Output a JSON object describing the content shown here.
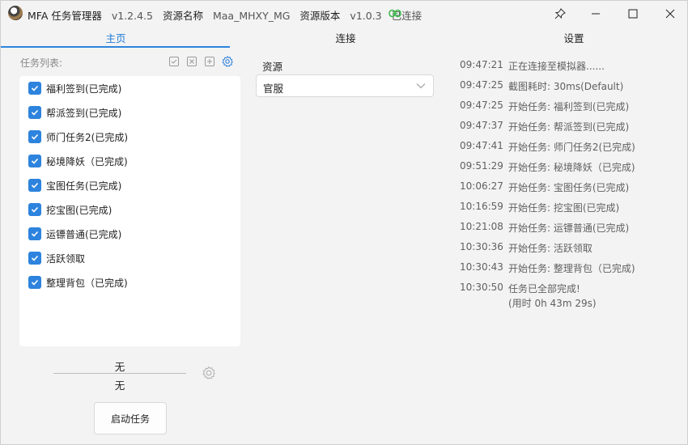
{
  "titlebar": {
    "app_name": "MFA 任务管理器",
    "version": "v1.2.4.5",
    "resource_name_label": "资源名称",
    "resource_name": "Maa_MHXY_MG",
    "resource_version_label": "资源版本",
    "resource_version": "v1.0.3",
    "connection_status": "已连接",
    "connection_color": "#3fb950"
  },
  "tabs": [
    {
      "label": "主页",
      "active": true
    },
    {
      "label": "连接",
      "active": false
    },
    {
      "label": "设置",
      "active": false
    }
  ],
  "task_panel": {
    "header": "任务列表:",
    "toolbar_icons": [
      "select-all-icon",
      "deselect-all-icon",
      "add-task-icon",
      "settings-icon"
    ],
    "items": [
      {
        "label": "福利签到(已完成)",
        "checked": true
      },
      {
        "label": "帮派签到(已完成)",
        "checked": true
      },
      {
        "label": "师门任务2(已完成)",
        "checked": true
      },
      {
        "label": "秘境降妖（已完成)",
        "checked": true
      },
      {
        "label": "宝图任务(已完成)",
        "checked": true
      },
      {
        "label": "挖宝图(已完成)",
        "checked": true
      },
      {
        "label": "运镖普通(已完成)",
        "checked": true
      },
      {
        "label": "活跃领取",
        "checked": true
      },
      {
        "label": "整理背包（已完成)",
        "checked": true
      }
    ]
  },
  "bottom_panel": {
    "value_top": "无",
    "value_bottom": "无",
    "start_button": "启动任务"
  },
  "resource": {
    "label": "资源",
    "selected": "官服"
  },
  "log": [
    {
      "time": "09:47:21",
      "message": "正在连接至模拟器......"
    },
    {
      "time": "09:47:25",
      "message": "截图耗时: 30ms(Default)"
    },
    {
      "time": "09:47:25",
      "message": "开始任务: 福利签到(已完成)"
    },
    {
      "time": "09:47:37",
      "message": "开始任务: 帮派签到(已完成)"
    },
    {
      "time": "09:47:41",
      "message": "开始任务: 师门任务2(已完成)"
    },
    {
      "time": "09:51:29",
      "message": "开始任务: 秘境降妖（已完成)"
    },
    {
      "time": "10:06:27",
      "message": "开始任务: 宝图任务(已完成)"
    },
    {
      "time": "10:16:59",
      "message": "开始任务: 挖宝图(已完成)"
    },
    {
      "time": "10:21:08",
      "message": "开始任务: 运镖普通(已完成)"
    },
    {
      "time": "10:30:36",
      "message": "开始任务: 活跃领取"
    },
    {
      "time": "10:30:43",
      "message": "开始任务: 整理背包（已完成)"
    },
    {
      "time": "10:30:50",
      "message": "任务已全部完成!",
      "message2": "(用时 0h 43m 29s)"
    }
  ],
  "colors": {
    "accent": "#2d83dd",
    "window_bg": "#f3f3f3"
  }
}
